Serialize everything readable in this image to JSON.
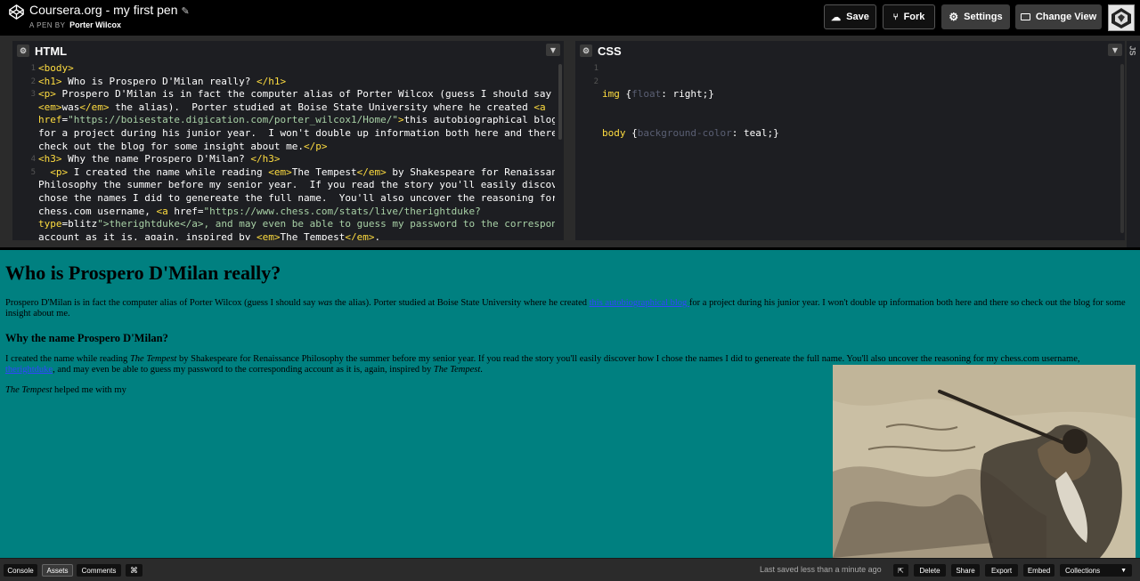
{
  "header": {
    "title": "Coursera.org - my first pen",
    "byline_prefix": "A PEN BY",
    "author": "Porter Wilcox",
    "buttons": {
      "save": "Save",
      "fork": "Fork",
      "settings": "Settings",
      "change_view": "Change View"
    }
  },
  "editors": {
    "html": {
      "label": "HTML",
      "lines": [
        "<body>",
        "<h1> Who is Prospero D'Milan really? </h1>",
        "<p> Prospero D'Milan is in fact the computer alias of Porter Wilcox (guess I should say",
        "<em>was</em> the alias).  Porter studied at Boise State University where he created <a",
        "href=\"https://boisestate.digication.com/porter_wilcox1/Home/\">this autobiographical blog </a>",
        "for a project during his junior year.  I won't double up information both here and there so",
        "check out the blog for some insight about me.</p>",
        "<h3> Why the name Prospero D'Milan? </h3>",
        "  <p> I created the name while reading <em>The Tempest</em> by Shakespeare for Renaissance",
        "Philosophy the summer before my senior year.  If you read the story you'll easily discover how I",
        "chose the names I did to genereate the full name.  You'll also uncover the reasoning for my",
        "chess.com username, <a href=\"https://www.chess.com/stats/live/therightduke?",
        "type=blitz\">therightduke</a>, and may even be able to guess my password to the corresponding",
        "account as it is, again, inspired by <em>The Tempest</em>."
      ],
      "gutter": [
        "1",
        "2",
        "3",
        "",
        "",
        "",
        "",
        "4",
        "5",
        "",
        "",
        "",
        "",
        ""
      ]
    },
    "css": {
      "label": "CSS",
      "line1_selector": "img",
      "line1_prop": "float",
      "line1_value": "right",
      "line2_selector": "body",
      "line2_prop": "background-color",
      "line2_value": "teal",
      "gutter": [
        "1",
        "2"
      ]
    },
    "js_label": "JS"
  },
  "preview": {
    "h1": "Who is Prospero D'Milan really?",
    "p1_a": "Prospero D'Milan is in fact the computer alias of Porter Wilcox (guess I should say ",
    "p1_em": "was",
    "p1_b": " the alias). Porter studied at Boise State University where he created ",
    "p1_link": "this autobiographical blog ",
    "p1_c": " for a project during his junior year. I won't double up information both here and there so check out the blog for some insight about me.",
    "h3": "Why the name Prospero D'Milan?",
    "p2_a": "I created the name while reading ",
    "p2_em1": "The Tempest",
    "p2_b": " by Shakespeare for Renaissance Philosophy the summer before my senior year. If you read the story you'll easily discover how I chose the names I did to genereate the full name. You'll also uncover the reasoning for my chess.com username, ",
    "p2_link": "therightduke",
    "p2_c": ", and may even be able to guess my password to the corresponding account as it is, again, inspired by ",
    "p2_em2": "The Tempest",
    "p2_d": ".",
    "p3_em": "The Tempest",
    "p3_rest": " helped me with my"
  },
  "footer": {
    "console": "Console",
    "assets": "Assets",
    "comments": "Comments",
    "shortcut": "⌘",
    "saved_status": "Last saved less than a minute ago",
    "delete": "Delete",
    "share": "Share",
    "export": "Export",
    "embed": "Embed",
    "collections": "Collections"
  },
  "colors": {
    "preview_bg": "#008080",
    "tag": "#ffdd40",
    "string": "#a8d1a6"
  }
}
